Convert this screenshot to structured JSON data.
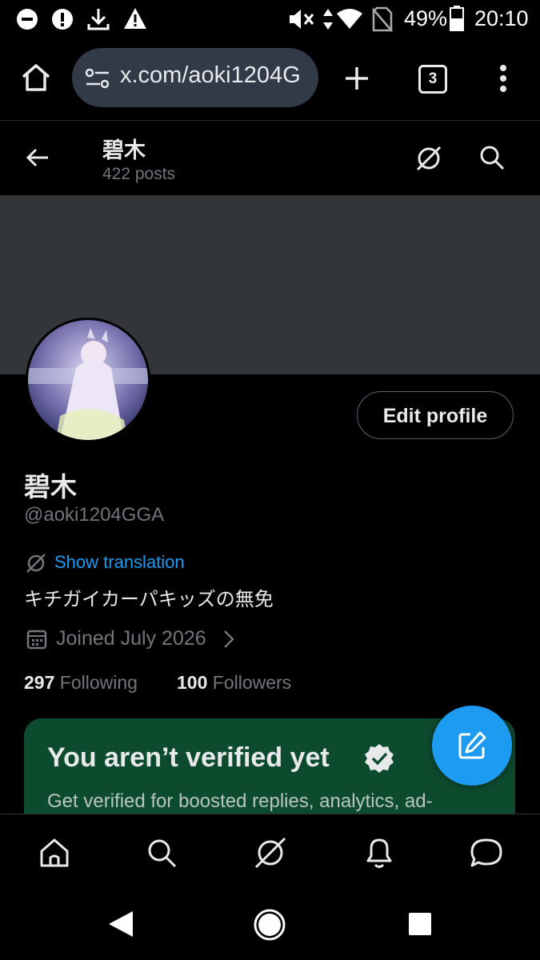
{
  "status_bar": {
    "battery_percent": "49%",
    "time": "20:10",
    "icons": [
      "do-not-disturb-icon",
      "alert-circle-icon",
      "download-icon",
      "warning-icon",
      "mute-icon",
      "data-arrows-icon",
      "wifi-icon",
      "no-sim-icon",
      "battery-icon"
    ]
  },
  "browser": {
    "url": "x.com/aoki1204G",
    "tab_count": "3",
    "icons": [
      "home-icon",
      "site-settings-icon",
      "new-tab-icon",
      "menu-dots-icon"
    ]
  },
  "header": {
    "name": "碧木",
    "posts": "422 posts"
  },
  "profile": {
    "display_name": "碧木",
    "handle": "@aoki1204GGA",
    "translate_label": "Show translation",
    "bio": "キチガイカーパキッズの無免",
    "joined": "Joined July 2026",
    "following_count": "297",
    "following_label": "Following",
    "followers_count": "100",
    "followers_label": "Followers",
    "edit_button": "Edit profile"
  },
  "verify_card": {
    "title": "You aren’t verified yet",
    "body": "Get verified for boosted replies, analytics, ad-"
  },
  "colors": {
    "accent": "#1d9bf0",
    "banner": "#333639",
    "card": "#0d4b2f",
    "muted": "#71767b"
  }
}
